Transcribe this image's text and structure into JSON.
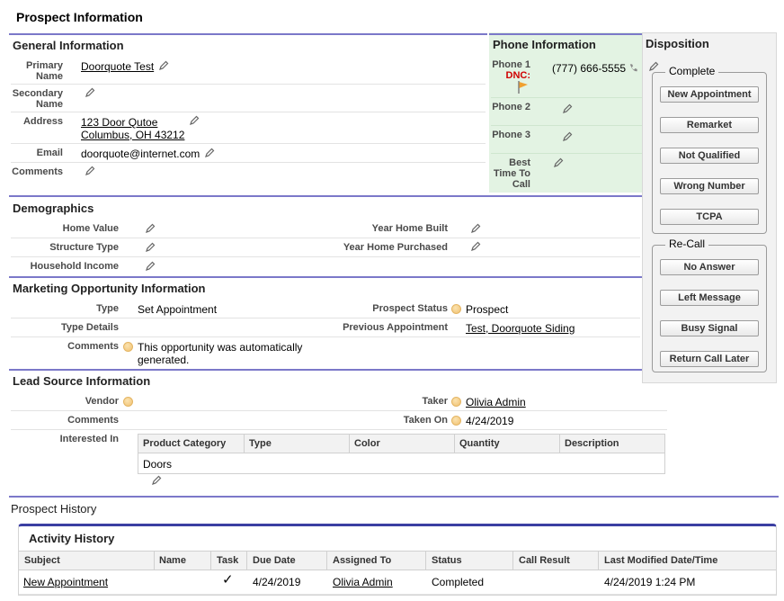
{
  "page_title": "Prospect Information",
  "general": {
    "title": "General Information",
    "primary_name_label": "Primary Name",
    "primary_name": "Doorquote Test",
    "secondary_name_label": "Secondary Name",
    "address_label": "Address",
    "address_line1": "123 Door Qutoe",
    "address_line2": "Columbus, OH 43212",
    "email_label": "Email",
    "email": "doorquote@internet.com",
    "comments_label": "Comments"
  },
  "phone": {
    "title": "Phone Information",
    "phone1_label": "Phone 1",
    "dnc": "DNC:",
    "phone1": "(777) 666-5555",
    "phone2_label": "Phone 2",
    "phone3_label": "Phone 3",
    "best_time_label": "Best Time To Call"
  },
  "disposition": {
    "title": "Disposition",
    "complete_legend": "Complete",
    "complete_buttons": [
      "New Appointment",
      "Remarket",
      "Not Qualified",
      "Wrong Number",
      "TCPA"
    ],
    "recall_legend": "Re-Call",
    "recall_buttons": [
      "No Answer",
      "Left Message",
      "Busy Signal",
      "Return Call Later"
    ]
  },
  "demographics": {
    "title": "Demographics",
    "home_value_label": "Home Value",
    "structure_type_label": "Structure Type",
    "household_income_label": "Household Income",
    "year_built_label": "Year Home Built",
    "year_purchased_label": "Year Home Purchased"
  },
  "marketing": {
    "title": "Marketing Opportunity Information",
    "type_label": "Type",
    "type": "Set Appointment",
    "type_details_label": "Type Details",
    "comments_label": "Comments",
    "comments": "This opportunity was automatically generated.",
    "prospect_status_label": "Prospect Status",
    "prospect_status": "Prospect",
    "previous_appt_label": "Previous Appointment",
    "previous_appt": "Test, Doorquote Siding"
  },
  "lead_source": {
    "title": "Lead Source Information",
    "vendor_label": "Vendor",
    "comments_label": "Comments",
    "interested_in_label": "Interested In",
    "taker_label": "Taker",
    "taker": "Olivia Admin",
    "taken_on_label": "Taken On",
    "taken_on": "4/24/2019",
    "columns": [
      "Product Category",
      "Type",
      "Color",
      "Quantity",
      "Description"
    ],
    "row_value": "Doors"
  },
  "history": {
    "title": "Prospect History",
    "activity_title": "Activity History",
    "columns": [
      "Subject",
      "Name",
      "Task",
      "Due Date",
      "Assigned To",
      "Status",
      "Call Result",
      "Last Modified Date/Time"
    ],
    "row": {
      "subject": "New Appointment",
      "name": "",
      "task": "✓",
      "due_date": "4/24/2019",
      "assigned_to": "Olivia Admin",
      "status": "Completed",
      "call_result": "",
      "last_modified": "4/24/2019 1:24 PM"
    }
  },
  "colors": {
    "section_rule": "#7b78c9",
    "phone_panel": "#e3f3e3",
    "dnc": "#d00000",
    "activity_accent": "#3b3fa2"
  }
}
